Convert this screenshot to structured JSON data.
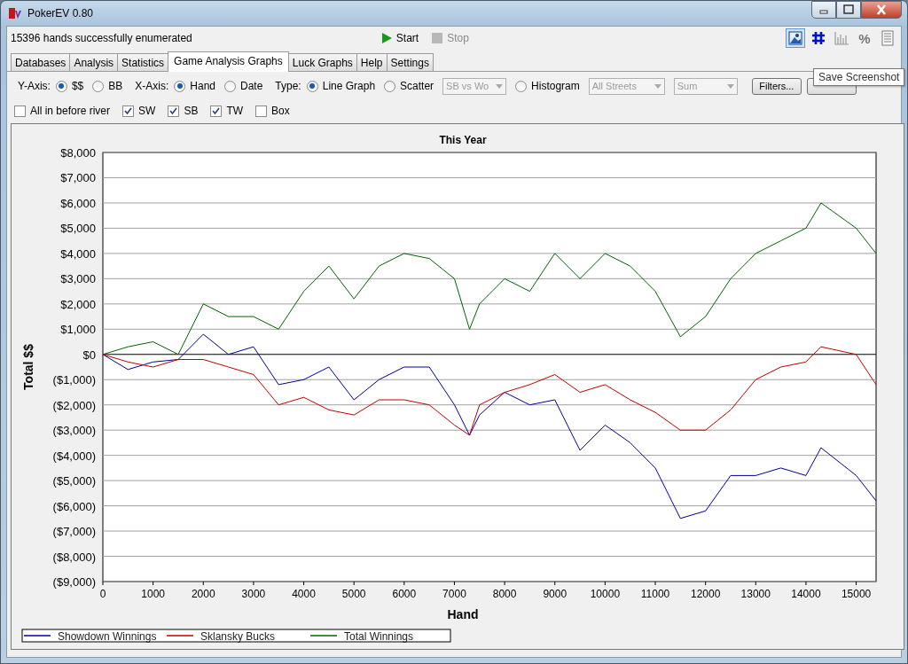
{
  "window": {
    "title": "PokerEV 0.80"
  },
  "status": "15396 hands successfully enumerated",
  "run_buttons": [
    {
      "kind": "start",
      "label": "Start",
      "disabled": false
    },
    {
      "kind": "stop",
      "label": "Stop",
      "disabled": true
    }
  ],
  "view_buttons": [
    {
      "kind": "screenshot",
      "selected": true
    },
    {
      "kind": "grid",
      "selected": false
    },
    {
      "kind": "bars",
      "selected": false
    },
    {
      "kind": "percent",
      "label": "%",
      "selected": false
    },
    {
      "kind": "list",
      "selected": false
    }
  ],
  "tabs": [
    {
      "label": "Databases",
      "selected": false
    },
    {
      "label": "Analysis",
      "selected": false
    },
    {
      "label": "Statistics",
      "selected": false
    },
    {
      "label": "Game Analysis Graphs",
      "selected": true
    },
    {
      "label": "Luck Graphs",
      "selected": false
    },
    {
      "label": "Help",
      "selected": false
    },
    {
      "label": "Settings",
      "selected": false
    }
  ],
  "options_row": [
    {
      "kind": "label",
      "label": "Y-Axis:"
    },
    {
      "kind": "radio",
      "label": "$$",
      "selected": true
    },
    {
      "kind": "radio",
      "label": "BB",
      "selected": false
    },
    {
      "kind": "label",
      "label": "X-Axis:"
    },
    {
      "kind": "radio",
      "label": "Hand",
      "selected": true
    },
    {
      "kind": "radio",
      "label": "Date",
      "selected": false
    },
    {
      "kind": "label",
      "label": "Type:"
    },
    {
      "kind": "radio",
      "label": "Line Graph",
      "selected": true
    },
    {
      "kind": "radio",
      "label": "Scatter",
      "selected": false
    },
    {
      "kind": "dropdown",
      "value": "SB vs Wo",
      "disabled": true
    },
    {
      "kind": "radio",
      "label": "Histogram",
      "selected": false
    },
    {
      "kind": "dropdown",
      "value": "All Streets",
      "disabled": true
    },
    {
      "kind": "dropdown",
      "value": "Sum",
      "disabled": true
    },
    {
      "kind": "button",
      "label": "Filters..."
    },
    {
      "kind": "button"
    }
  ],
  "tooltip": "Save Screenshot",
  "checkboxes": [
    {
      "label": "All in before river",
      "checked": false
    },
    {
      "label": "SW",
      "checked": true
    },
    {
      "label": "SB",
      "checked": true
    },
    {
      "label": "TW",
      "checked": true
    },
    {
      "label": "Box",
      "checked": false
    }
  ],
  "chart": {
    "chart_data": {
      "type": "line",
      "title": "This Year",
      "xlabel": "Hand",
      "ylabel": "Total $$",
      "x": [
        0,
        500,
        1000,
        1500,
        2000,
        2500,
        3000,
        3500,
        4000,
        4500,
        5000,
        5500,
        6000,
        6500,
        7000,
        7300,
        7500,
        8000,
        8500,
        9000,
        9500,
        10000,
        10500,
        11000,
        11500,
        12000,
        12500,
        13000,
        13500,
        14000,
        14300,
        15000,
        15396
      ],
      "series": [
        {
          "name": "Showdown Winnings",
          "color": "#0000a0",
          "values": [
            0,
            -600,
            -300,
            -200,
            800,
            0,
            300,
            -1200,
            -1000,
            -500,
            -1800,
            -1000,
            -500,
            -500,
            -2000,
            -3200,
            -2400,
            -1500,
            -2000,
            -1800,
            -3800,
            -2800,
            -3500,
            -4500,
            -6500,
            -6200,
            -4800,
            -4800,
            -4500,
            -4800,
            -3700,
            -4800,
            -5800
          ]
        },
        {
          "name": "Sklansky Bucks",
          "color": "#c00000",
          "values": [
            0,
            -300,
            -500,
            -200,
            -200,
            -500,
            -800,
            -2000,
            -1700,
            -2200,
            -2400,
            -1800,
            -1800,
            -2000,
            -2800,
            -3200,
            -2000,
            -1500,
            -1200,
            -800,
            -1500,
            -1200,
            -1800,
            -2300,
            -3000,
            -3000,
            -2200,
            -1000,
            -500,
            -300,
            300,
            0,
            -1200
          ]
        },
        {
          "name": "Total Winnings",
          "color": "#006400",
          "values": [
            0,
            300,
            500,
            0,
            2000,
            1500,
            1500,
            1000,
            2500,
            3500,
            2200,
            3500,
            4000,
            3800,
            3000,
            1000,
            2000,
            3000,
            2500,
            4000,
            3000,
            4000,
            3500,
            2500,
            700,
            1500,
            3000,
            4000,
            4500,
            5000,
            6000,
            5000,
            4000
          ]
        }
      ],
      "grid": true,
      "legend": true,
      "xlim": [
        0,
        15396
      ],
      "ylim": [
        -9000,
        8000
      ],
      "xticks": [
        0,
        1000,
        2000,
        3000,
        4000,
        5000,
        6000,
        7000,
        8000,
        9000,
        10000,
        11000,
        12000,
        13000,
        14000,
        15000
      ],
      "yticks": [
        {
          "value": 8000,
          "label": "$8,000"
        },
        {
          "value": 7000,
          "label": "$7,000"
        },
        {
          "value": 6000,
          "label": "$6,000"
        },
        {
          "value": 5000,
          "label": "$5,000"
        },
        {
          "value": 4000,
          "label": "$4,000"
        },
        {
          "value": 3000,
          "label": "$3,000"
        },
        {
          "value": 2000,
          "label": "$2,000"
        },
        {
          "value": 1000,
          "label": "$1,000"
        },
        {
          "value": 0,
          "label": "$0"
        },
        {
          "value": -1000,
          "label": "($1,000)"
        },
        {
          "value": -2000,
          "label": "($2,000)"
        },
        {
          "value": -3000,
          "label": "($3,000)"
        },
        {
          "value": -4000,
          "label": "($4,000)"
        },
        {
          "value": -5000,
          "label": "($5,000)"
        },
        {
          "value": -6000,
          "label": "($6,000)"
        },
        {
          "value": -7000,
          "label": "($7,000)"
        },
        {
          "value": -8000,
          "label": "($8,000)"
        },
        {
          "value": -9000,
          "label": "($9,000)"
        }
      ]
    }
  }
}
